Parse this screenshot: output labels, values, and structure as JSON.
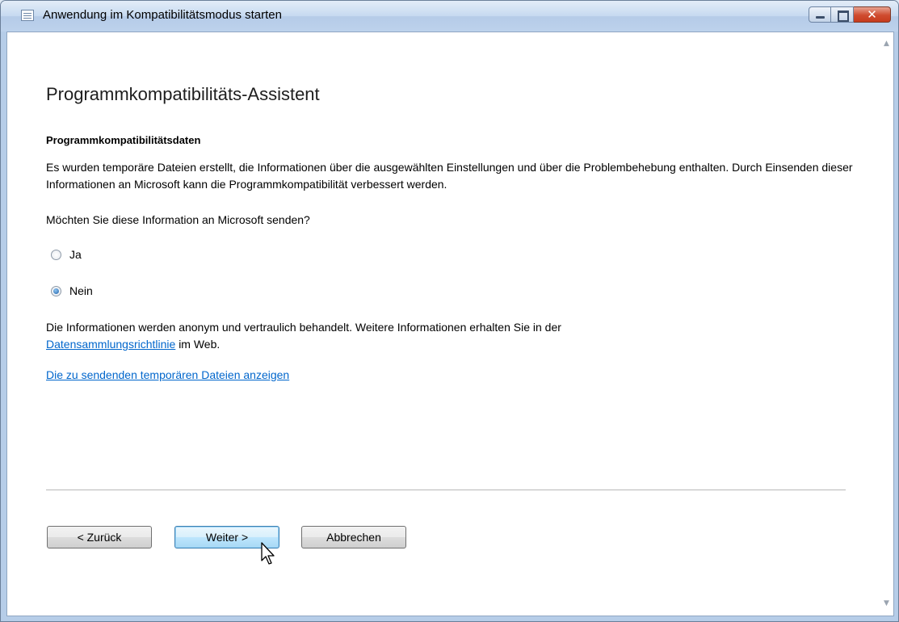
{
  "window": {
    "title": "Anwendung im Kompatibilitätsmodus starten"
  },
  "page": {
    "heading": "Programmkompatibilitäts-Assistent",
    "section_title": "Programmkompatibilitätsdaten",
    "intro": "Es wurden temporäre Dateien erstellt, die Informationen über die ausgewählten Einstellungen und über die Problembehebung enthalten. Durch Einsenden dieser Informationen an Microsoft kann die Programmkompatibilität verbessert werden.",
    "question": "Möchten Sie diese Information an Microsoft senden?",
    "options": [
      {
        "label": "Ja",
        "checked": false
      },
      {
        "label": "Nein",
        "checked": true
      }
    ],
    "privacy_text_before": "Die Informationen werden anonym und vertraulich behandelt. Weitere Informationen erhalten Sie in der",
    "privacy_link": "Datensammlungsrichtlinie",
    "privacy_text_after": "im Web.",
    "show_files_link": "Die zu sendenden temporären Dateien anzeigen"
  },
  "buttons": {
    "back": "< Zurück",
    "next": "Weiter >",
    "cancel": "Abbrechen"
  },
  "icons": [
    "app-icon",
    "minimize-icon",
    "maximize-icon",
    "close-icon",
    "scroll-up-icon",
    "scroll-down-icon",
    "mouse-cursor-icon"
  ]
}
